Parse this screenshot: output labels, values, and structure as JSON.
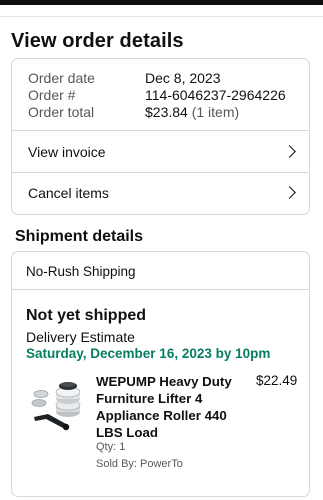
{
  "page": {
    "title": "View order details"
  },
  "order": {
    "date_label": "Order date",
    "date_value": "Dec 8, 2023",
    "number_label": "Order #",
    "number_value": "114-6046237-2964226",
    "total_label": "Order total",
    "total_value": "$23.84",
    "total_items": "(1 item)"
  },
  "actions": {
    "view_invoice": "View invoice",
    "cancel_items": "Cancel items"
  },
  "shipment": {
    "section_title": "Shipment details",
    "method": "No-Rush Shipping",
    "status": "Not yet shipped",
    "estimate_label": "Delivery Estimate",
    "estimate_date": "Saturday, December 16, 2023 by 10pm"
  },
  "product": {
    "title": "WEPUMP Heavy Duty Furniture Lifter 4 Appliance Roller 440 LBS Load",
    "price": "$22.49",
    "qty": "Qty: 1",
    "seller": "Sold By: PowerTo",
    "image_icon": "furniture-lifter-product-image"
  },
  "colors": {
    "accent_green": "#067d62",
    "border": "#d5d9d9",
    "text_secondary": "#565959"
  }
}
